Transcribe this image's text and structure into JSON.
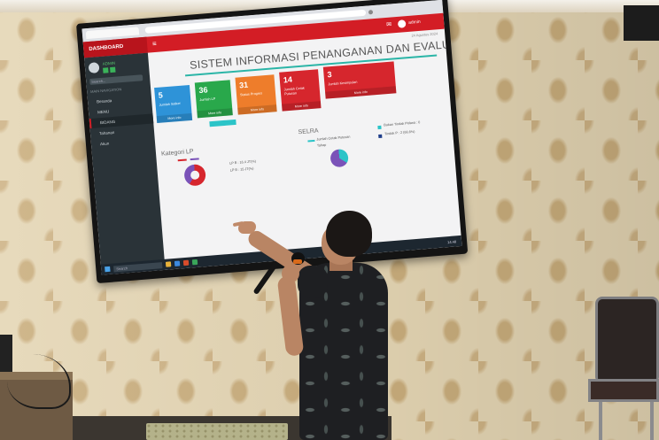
{
  "screen": {
    "brand": "DASHBOARD",
    "user_name": "admin",
    "date_text": "24 Agustus 2024",
    "sidebar": {
      "user": "ADMIN",
      "search_placeholder": "Search...",
      "section": "MAIN NAVIGATION",
      "items": [
        "Beranda",
        "MENU",
        "BIDANG",
        "Tahanan",
        "Akun"
      ]
    },
    "title": "SISTEM INFORMASI PENANGANAN DAN EVALU",
    "stat_boxes": [
      {
        "number": "5",
        "label": "Jumlah Satker",
        "more": "More info",
        "color": "#2e93d8"
      },
      {
        "number": "36",
        "label": "Jumlah LP",
        "more": "More info",
        "color": "#29a84b"
      },
      {
        "number": "31",
        "label": "Status Progres",
        "more": "More info",
        "color": "#ee7d2b"
      },
      {
        "number": "14",
        "label": "Jumlah Cetak Putusan",
        "more": "More info",
        "color": "#d6262d"
      },
      {
        "number": "3",
        "label": "Jumlah Kesimpulan",
        "more": "More info",
        "color": "#d6262d"
      }
    ],
    "panels": {
      "kategori_title": "Kategori LP",
      "selra_title": "SELRA",
      "lp_lines": [
        "LP B : 16.4 JT(%)",
        "LP B : 15 JT(%)"
      ],
      "legend_right": [
        "Bukan Tindak Pidana : 0",
        "Tindak P : 2 (66.6%)"
      ],
      "selra_legend": [
        "Jumlah Cetak Putusan",
        "Tahap"
      ]
    },
    "taskbar": {
      "search_label": "Search",
      "clock": "14:48"
    }
  },
  "colors": {
    "topbar": "#d31d25",
    "sidebar": "#2a3338",
    "accent_line": "#2bb5a7"
  }
}
